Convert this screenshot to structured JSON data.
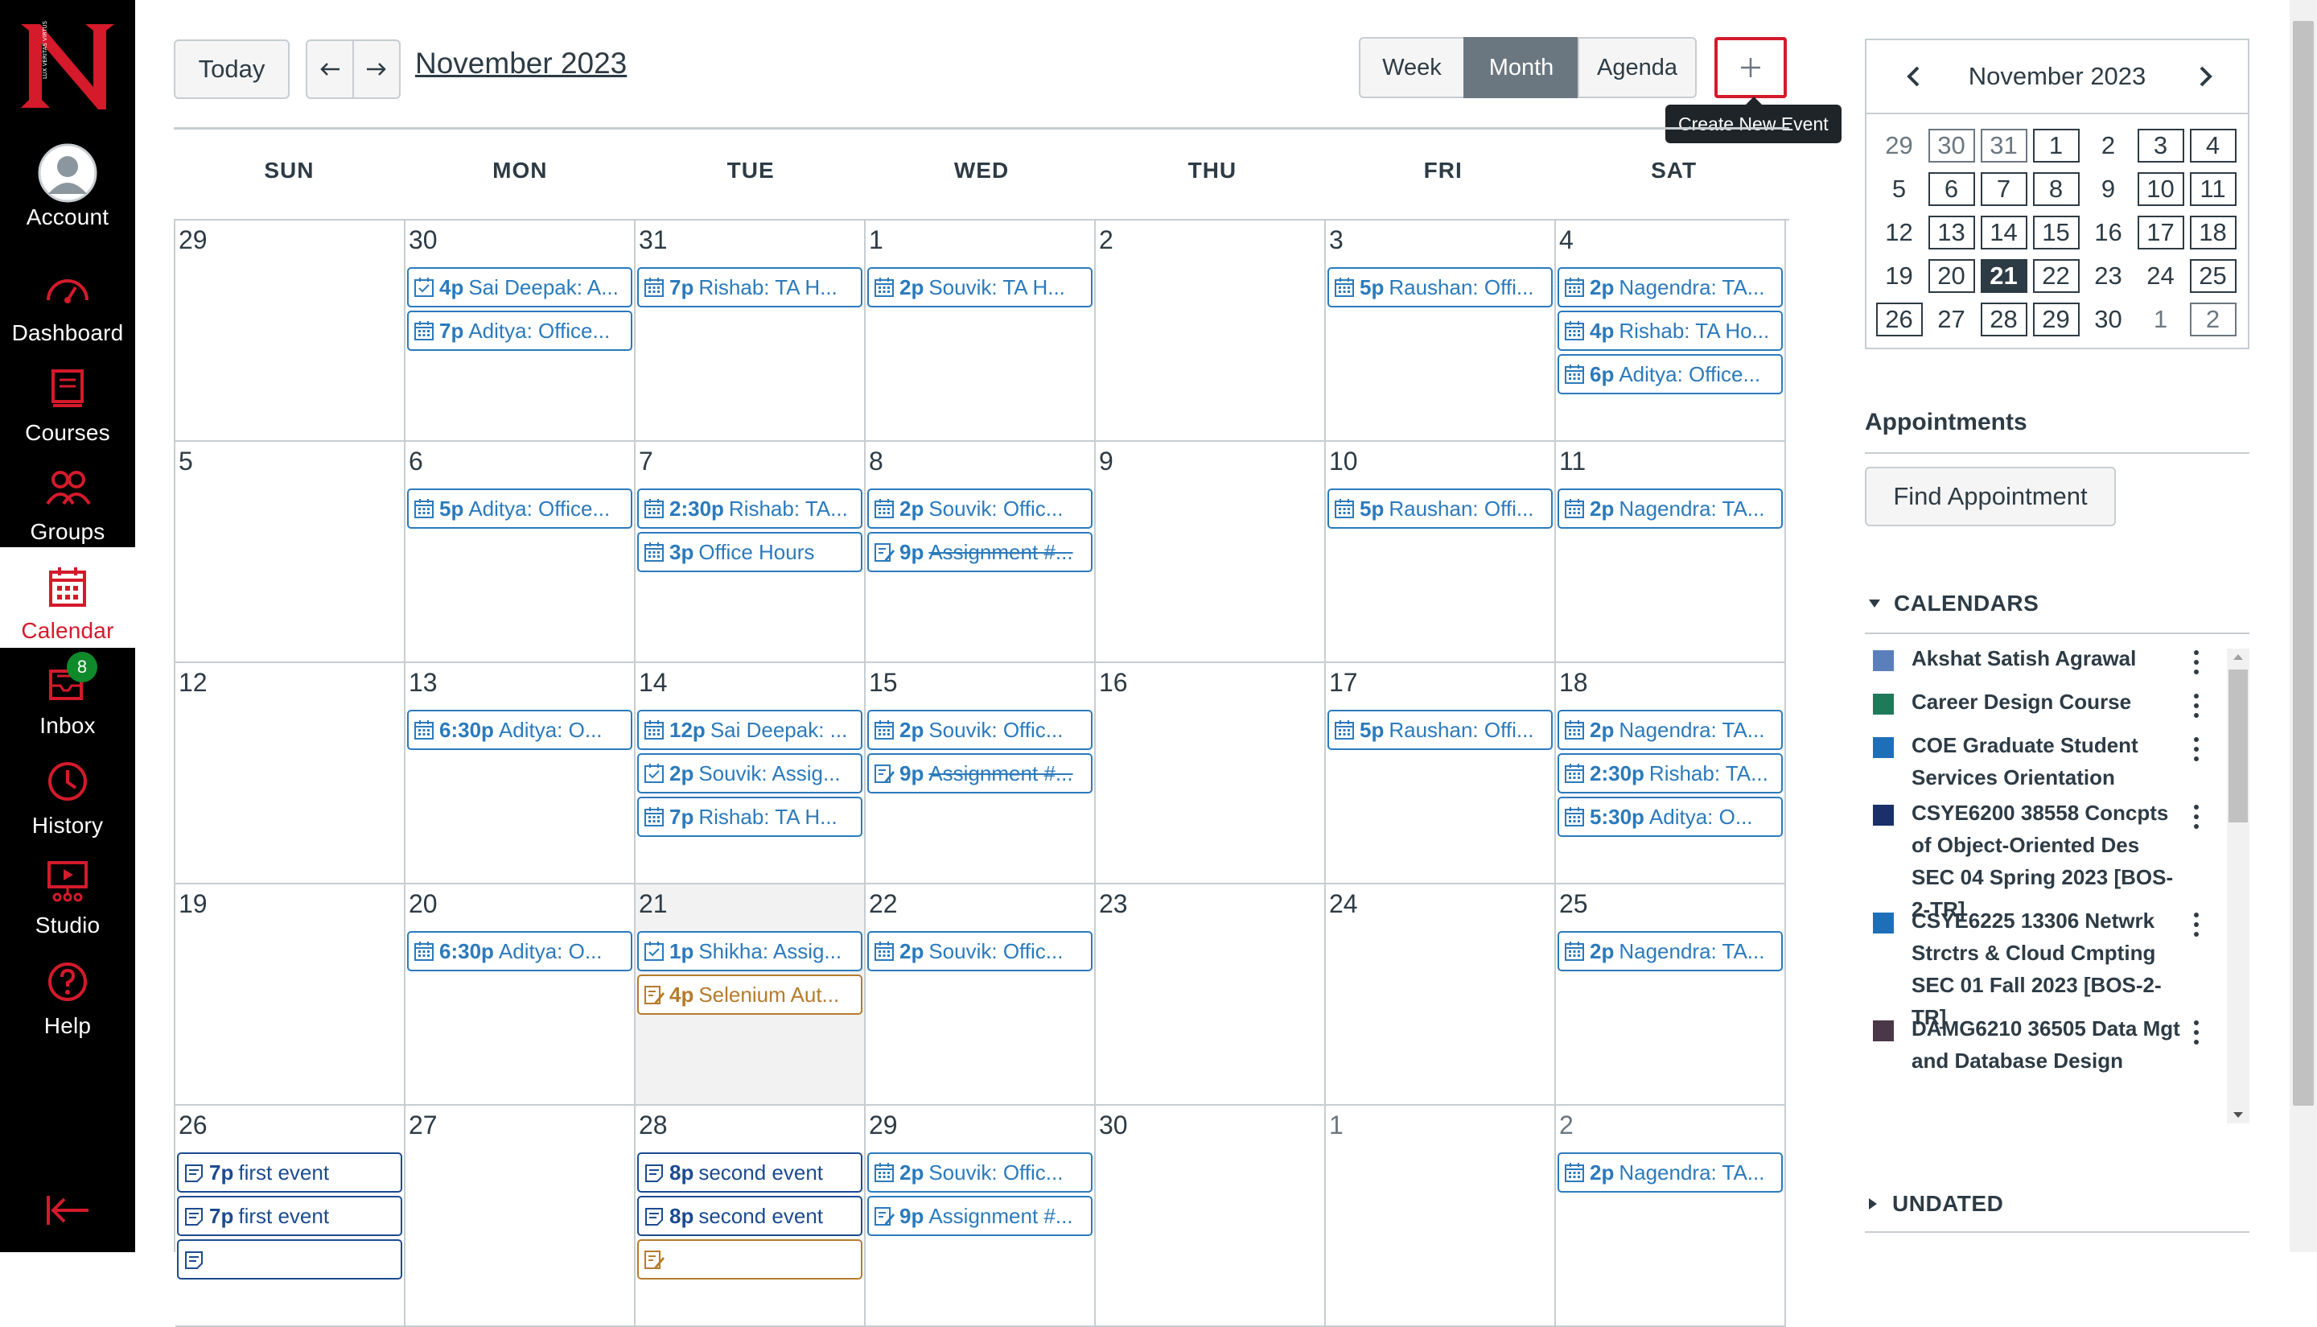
{
  "nav": {
    "items": [
      {
        "key": "account",
        "label": "Account",
        "icon": "user-avatar-icon"
      },
      {
        "key": "dashboard",
        "label": "Dashboard",
        "icon": "dashboard-gauge-icon"
      },
      {
        "key": "courses",
        "label": "Courses",
        "icon": "book-icon"
      },
      {
        "key": "groups",
        "label": "Groups",
        "icon": "people-icon"
      },
      {
        "key": "calendar",
        "label": "Calendar",
        "icon": "calendar-icon",
        "active": true
      },
      {
        "key": "inbox",
        "label": "Inbox",
        "icon": "inbox-icon",
        "badge": "8"
      },
      {
        "key": "history",
        "label": "History",
        "icon": "clock-icon"
      },
      {
        "key": "studio",
        "label": "Studio",
        "icon": "studio-screen-icon"
      },
      {
        "key": "help",
        "label": "Help",
        "icon": "question-icon"
      }
    ],
    "collapse_icon": "collapse-arrow-icon",
    "logo_text": "LUX VERITAS VIRTUS"
  },
  "toolbar": {
    "today": "Today",
    "month_title": "November 2023",
    "views": [
      "Week",
      "Month",
      "Agenda"
    ],
    "active_view": "Month",
    "add_tooltip": "Create New Event"
  },
  "weekdays": [
    "SUN",
    "MON",
    "TUE",
    "WED",
    "THU",
    "FRI",
    "SAT"
  ],
  "weeks": [
    [
      {
        "day": "29",
        "other": false,
        "events": []
      },
      {
        "day": "30",
        "events": [
          {
            "time": "4p",
            "name": "Sai Deepak: A...",
            "icon": "assignment-check"
          },
          {
            "time": "7p",
            "name": "Aditya: Office...",
            "icon": "calendar"
          }
        ]
      },
      {
        "day": "31",
        "events": [
          {
            "time": "7p",
            "name": "Rishab: TA H...",
            "icon": "calendar"
          }
        ]
      },
      {
        "day": "1",
        "events": [
          {
            "time": "2p",
            "name": "Souvik: TA H...",
            "icon": "calendar"
          }
        ]
      },
      {
        "day": "2",
        "events": []
      },
      {
        "day": "3",
        "events": [
          {
            "time": "5p",
            "name": "Raushan: Offi...",
            "icon": "calendar"
          }
        ]
      },
      {
        "day": "4",
        "events": [
          {
            "time": "2p",
            "name": "Nagendra: TA...",
            "icon": "calendar"
          },
          {
            "time": "4p",
            "name": "Rishab: TA Ho...",
            "icon": "calendar"
          },
          {
            "time": "6p",
            "name": "Aditya: Office...",
            "icon": "calendar"
          }
        ]
      }
    ],
    [
      {
        "day": "5",
        "events": []
      },
      {
        "day": "6",
        "events": [
          {
            "time": "5p",
            "name": "Aditya: Office...",
            "icon": "calendar"
          }
        ]
      },
      {
        "day": "7",
        "events": [
          {
            "time": "2:30p",
            "name": "Rishab: TA...",
            "icon": "calendar"
          },
          {
            "time": "3p",
            "name": "Office Hours",
            "icon": "calendar"
          }
        ]
      },
      {
        "day": "8",
        "events": [
          {
            "time": "2p",
            "name": "Souvik: Offic...",
            "icon": "calendar"
          },
          {
            "time": "9p",
            "name": "Assignment #...",
            "icon": "assignment",
            "strike": true
          }
        ]
      },
      {
        "day": "9",
        "events": []
      },
      {
        "day": "10",
        "events": [
          {
            "time": "5p",
            "name": "Raushan: Offi...",
            "icon": "calendar"
          }
        ]
      },
      {
        "day": "11",
        "events": [
          {
            "time": "2p",
            "name": "Nagendra: TA...",
            "icon": "calendar"
          }
        ]
      }
    ],
    [
      {
        "day": "12",
        "events": []
      },
      {
        "day": "13",
        "events": [
          {
            "time": "6:30p",
            "name": "Aditya: O...",
            "icon": "calendar"
          }
        ]
      },
      {
        "day": "14",
        "events": [
          {
            "time": "12p",
            "name": "Sai Deepak: ...",
            "icon": "calendar"
          },
          {
            "time": "2p",
            "name": "Souvik: Assig...",
            "icon": "assignment-check"
          },
          {
            "time": "7p",
            "name": "Rishab: TA H...",
            "icon": "calendar"
          }
        ]
      },
      {
        "day": "15",
        "events": [
          {
            "time": "2p",
            "name": "Souvik: Offic...",
            "icon": "calendar"
          },
          {
            "time": "9p",
            "name": "Assignment #...",
            "icon": "assignment",
            "strike": true
          }
        ]
      },
      {
        "day": "16",
        "events": []
      },
      {
        "day": "17",
        "events": [
          {
            "time": "5p",
            "name": "Raushan: Offi...",
            "icon": "calendar"
          }
        ]
      },
      {
        "day": "18",
        "events": [
          {
            "time": "2p",
            "name": "Nagendra: TA...",
            "icon": "calendar"
          },
          {
            "time": "2:30p",
            "name": "Rishab: TA...",
            "icon": "calendar"
          },
          {
            "time": "5:30p",
            "name": "Aditya: O...",
            "icon": "calendar"
          }
        ]
      }
    ],
    [
      {
        "day": "19",
        "events": []
      },
      {
        "day": "20",
        "events": [
          {
            "time": "6:30p",
            "name": "Aditya: O...",
            "icon": "calendar"
          }
        ]
      },
      {
        "day": "21",
        "today": true,
        "events": [
          {
            "time": "1p",
            "name": "Shikha: Assig...",
            "icon": "assignment-check"
          },
          {
            "time": "4p",
            "name": "Selenium Aut...",
            "icon": "assignment",
            "color": "orange"
          }
        ]
      },
      {
        "day": "22",
        "events": [
          {
            "time": "2p",
            "name": "Souvik: Offic...",
            "icon": "calendar"
          }
        ]
      },
      {
        "day": "23",
        "events": []
      },
      {
        "day": "24",
        "events": []
      },
      {
        "day": "25",
        "events": [
          {
            "time": "2p",
            "name": "Nagendra: TA...",
            "icon": "calendar"
          }
        ]
      }
    ],
    [
      {
        "day": "26",
        "events": [
          {
            "time": "7p",
            "name": "first event",
            "icon": "note",
            "color": "navy"
          },
          {
            "time": "7p",
            "name": "first event",
            "icon": "note",
            "color": "navy"
          },
          {
            "time": "",
            "name": "",
            "icon": "note",
            "color": "navy"
          }
        ]
      },
      {
        "day": "27",
        "events": []
      },
      {
        "day": "28",
        "events": [
          {
            "time": "8p",
            "name": "second event",
            "icon": "note",
            "color": "navy"
          },
          {
            "time": "8p",
            "name": "second event",
            "icon": "note",
            "color": "navy"
          },
          {
            "time": "",
            "name": "",
            "icon": "assignment",
            "color": "orange"
          }
        ]
      },
      {
        "day": "29",
        "events": [
          {
            "time": "2p",
            "name": "Souvik: Offic...",
            "icon": "calendar"
          },
          {
            "time": "9p",
            "name": "Assignment #...",
            "icon": "assignment"
          }
        ]
      },
      {
        "day": "30",
        "events": []
      },
      {
        "day": "1",
        "other": true,
        "events": []
      },
      {
        "day": "2",
        "other": true,
        "events": [
          {
            "time": "2p",
            "name": "Nagendra: TA...",
            "icon": "calendar"
          }
        ]
      }
    ]
  ],
  "mini_calendar": {
    "title": "November 2023",
    "days": [
      {
        "d": "29",
        "o": true,
        "b": false
      },
      {
        "d": "30",
        "o": true,
        "b": true
      },
      {
        "d": "31",
        "o": true,
        "b": true
      },
      {
        "d": "1",
        "b": true
      },
      {
        "d": "2",
        "b": false
      },
      {
        "d": "3",
        "b": true
      },
      {
        "d": "4",
        "b": true
      },
      {
        "d": "5",
        "b": false
      },
      {
        "d": "6",
        "b": true
      },
      {
        "d": "7",
        "b": true
      },
      {
        "d": "8",
        "b": true
      },
      {
        "d": "9",
        "b": false
      },
      {
        "d": "10",
        "b": true
      },
      {
        "d": "11",
        "b": true
      },
      {
        "d": "12",
        "b": false
      },
      {
        "d": "13",
        "b": true
      },
      {
        "d": "14",
        "b": true
      },
      {
        "d": "15",
        "b": true
      },
      {
        "d": "16",
        "b": false
      },
      {
        "d": "17",
        "b": true
      },
      {
        "d": "18",
        "b": true
      },
      {
        "d": "19",
        "b": false
      },
      {
        "d": "20",
        "b": true
      },
      {
        "d": "21",
        "b": false,
        "t": true
      },
      {
        "d": "22",
        "b": true
      },
      {
        "d": "23",
        "b": false
      },
      {
        "d": "24",
        "b": false
      },
      {
        "d": "25",
        "b": true
      },
      {
        "d": "26",
        "b": true
      },
      {
        "d": "27",
        "b": false
      },
      {
        "d": "28",
        "b": true
      },
      {
        "d": "29",
        "b": true
      },
      {
        "d": "30",
        "b": false
      },
      {
        "d": "1",
        "o": true,
        "b": false
      },
      {
        "d": "2",
        "o": true,
        "b": true
      }
    ]
  },
  "appointments": {
    "heading": "Appointments",
    "find": "Find Appointment"
  },
  "calendars": {
    "heading": "CALENDARS",
    "items": [
      {
        "name": "Akshat Satish Agrawal",
        "color": "#5b7fbd"
      },
      {
        "name": "Career Design Course",
        "color": "#1f7a5a"
      },
      {
        "name": "COE Graduate Student Services Orientation",
        "color": "#1f6fb8"
      },
      {
        "name": "CSYE6200 38558 Concpts of Object-Oriented Des SEC 04 Spring 2023 [BOS-2-TR]",
        "color": "#1b2f6b"
      },
      {
        "name": "CSYE6225 13306 Netwrk Strctrs & Cloud Cmpting SEC 01 Fall 2023 [BOS-2-TR]",
        "color": "#1f6fb8"
      },
      {
        "name": "DAMG6210 36505 Data Mgt and Database Design",
        "color": "#4a3748"
      }
    ]
  },
  "undated": {
    "heading": "UNDATED"
  }
}
